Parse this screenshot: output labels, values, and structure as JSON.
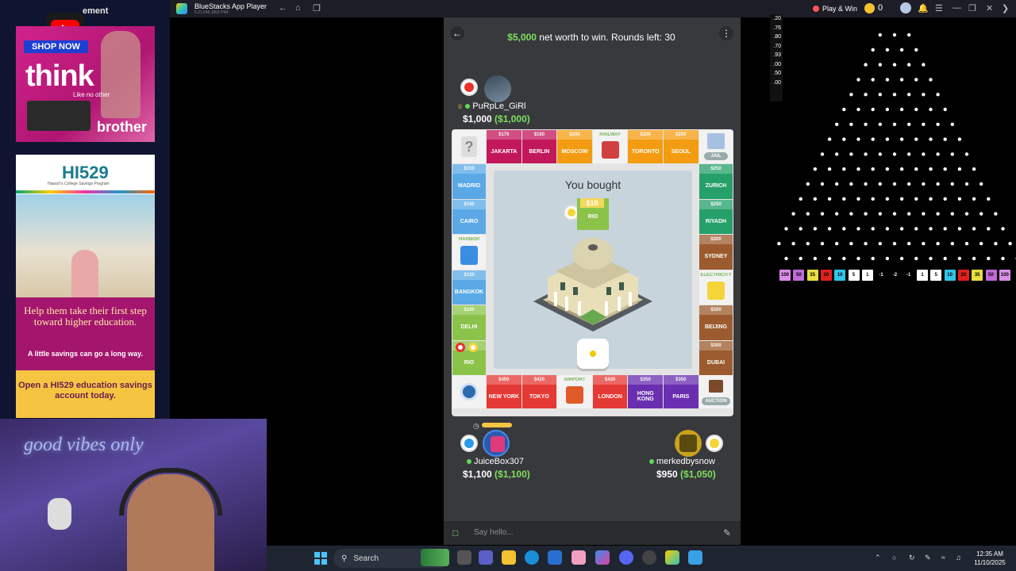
{
  "left_ads": {
    "ad_label": "ement",
    "ad1": {
      "shop": "SHOP NOW",
      "headline": "think",
      "tagline": "Like no other",
      "brand": "brother"
    },
    "ad2": {
      "logo": "HI529",
      "logo_sub": "Hawaiʻi's College Savings Program",
      "headline": "Help them take their first step toward higher education.",
      "sub": "A little savings can go a long way.",
      "cta": "Open a HI529 education savings account today."
    }
  },
  "webcam": {
    "neon_text": "good vibes only"
  },
  "window": {
    "title": "BlueStacks App Player",
    "version": "5.21.640.1002 P64",
    "play_win": "Play & Win",
    "coin_count": "0"
  },
  "game": {
    "goal_amount": "$5,000",
    "goal_rest": " net worth to win. Rounds left: 30",
    "you_bought": "You bought",
    "bought_price": "$10",
    "bought_name": "RIO",
    "players": [
      {
        "name": "PuRpLe_GiRl",
        "money": "$1,000",
        "net_worth": "($1,000)",
        "token_color": "#e8322b"
      },
      {
        "name": "JuiceBox307",
        "money": "$1,100",
        "net_worth": "($1,100)",
        "token_color": "#2b9be8"
      },
      {
        "name": "merkedbysnow",
        "money": "$950",
        "net_worth": "($1,050)",
        "token_color": "#f5d43a"
      }
    ],
    "board": {
      "top": [
        {
          "price": "$170",
          "name": "JAKARTA",
          "color": "#c2185b"
        },
        {
          "price": "$180",
          "name": "BERLIN",
          "color": "#c2185b"
        },
        {
          "price": "$200",
          "name": "MOSCOW",
          "color": "#f39c12"
        },
        {
          "price": "RAILWAY",
          "name": "",
          "color": "#f2f2f2"
        },
        {
          "price": "$200",
          "name": "TORONTO",
          "color": "#f39c12"
        },
        {
          "price": "$200",
          "name": "SEOUL",
          "color": "#f39c12"
        }
      ],
      "left": [
        {
          "price": "$150",
          "name": "MADRID",
          "color": "#5aa9e6"
        },
        {
          "price": "$150",
          "name": "CAIRO",
          "color": "#5aa9e6"
        },
        {
          "price": "HARBOR",
          "name": "",
          "color": "#f2f2f2"
        },
        {
          "price": "$130",
          "name": "BANGKOK",
          "color": "#5aa9e6"
        },
        {
          "price": "$100",
          "name": "DELHI",
          "color": "#8bc34a"
        },
        {
          "price": "",
          "name": "RIO",
          "color": "#8bc34a"
        }
      ],
      "right": [
        {
          "price": "$250",
          "name": "ZURICH",
          "color": "#26a06b"
        },
        {
          "price": "$250",
          "name": "RIYADH",
          "color": "#26a06b"
        },
        {
          "price": "$300",
          "name": "SYDNEY",
          "color": "#9c5b2e"
        },
        {
          "price": "ELECTRICITY",
          "name": "",
          "color": "#f2f2f2"
        },
        {
          "price": "$300",
          "name": "BEIJING",
          "color": "#9c5b2e"
        },
        {
          "price": "$300",
          "name": "DUBAI",
          "color": "#9c5b2e"
        }
      ],
      "bottom": [
        {
          "price": "$450",
          "name": "NEW YORK",
          "color": "#e53935"
        },
        {
          "price": "$420",
          "name": "TOKYO",
          "color": "#e53935"
        },
        {
          "price": "AIRPORT",
          "name": "",
          "color": "#f2f2f2"
        },
        {
          "price": "$420",
          "name": "LONDON",
          "color": "#e53935"
        },
        {
          "price": "$350",
          "name": "HONG KONG",
          "color": "#6a2fb0"
        },
        {
          "price": "$350",
          "name": "PARIS",
          "color": "#6a2fb0"
        }
      ],
      "corners": {
        "top_left": "?",
        "top_right": "JAIL",
        "bottom_left": "",
        "bottom_right": "AUCTION"
      }
    },
    "chat_placeholder": "Say hello..."
  },
  "plinko": {
    "odds": [
      ".20",
      ".76",
      ".80",
      ".70",
      ".93",
      ".00",
      ".50",
      ".00"
    ],
    "multipliers": [
      "100",
      "50",
      "35",
      "20",
      "10",
      "5",
      "1",
      "-1",
      "-2",
      "-1",
      "1",
      "5",
      "10",
      "20",
      "35",
      "50",
      "100"
    ],
    "multiplier_colors": [
      "#d98ee8",
      "#c06bd6",
      "#e8e040",
      "#e02020",
      "#30c6e8",
      "#ffffff",
      "#ffffff",
      "#000000",
      "#000000",
      "#000000",
      "#ffffff",
      "#ffffff",
      "#30c6e8",
      "#e02020",
      "#e8e040",
      "#c06bd6",
      "#d98ee8"
    ]
  },
  "taskbar": {
    "search_label": "Search",
    "time": "12:35 AM",
    "date": "11/10/2025"
  }
}
